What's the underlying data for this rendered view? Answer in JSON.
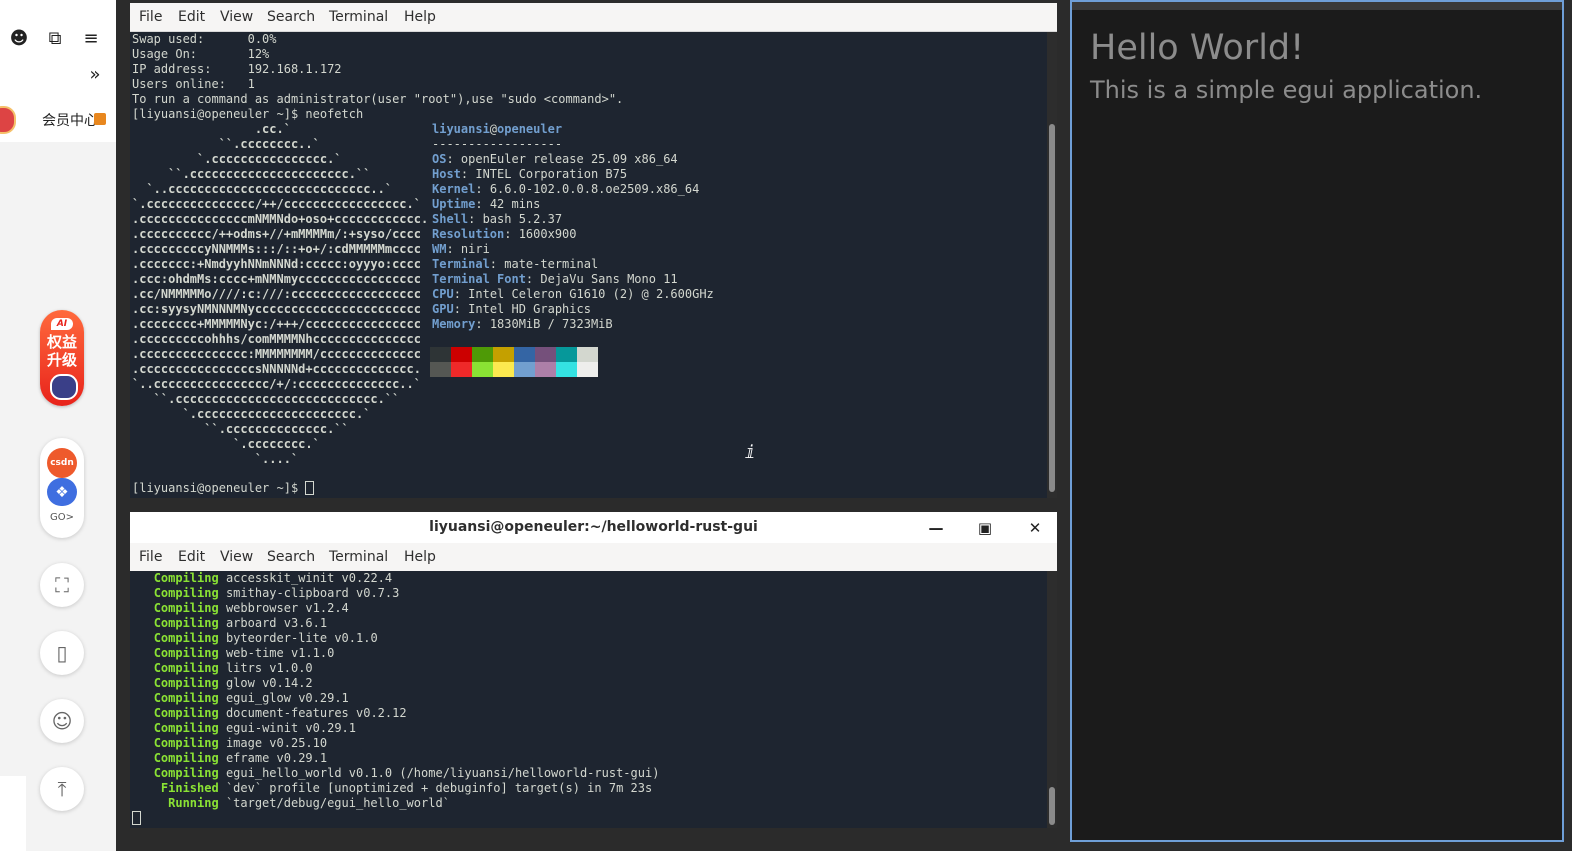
{
  "browser": {
    "toolbar": {
      "account_icon": "account-circle-icon",
      "extensions_icon": "puzzle-icon",
      "menu_icon": "hamburger-menu-icon",
      "more_icon": "double-chevron-right-icon"
    },
    "member_center": "会员中心",
    "promo": {
      "badge": "AI",
      "line1": "权益",
      "line2": "升级"
    },
    "csdn": {
      "logo": "csdn",
      "go": "GO>"
    },
    "side_buttons": [
      "fullscreen-icon",
      "mobile-icon",
      "chat-icon",
      "back-to-top-icon"
    ]
  },
  "term_top": {
    "menu": [
      "File",
      "Edit",
      "View",
      "Search",
      "Terminal",
      "Help"
    ],
    "sysinfo": [
      {
        "label": "Swap used:",
        "value": "0.0%"
      },
      {
        "label": "Usage On:",
        "value": "12%"
      },
      {
        "label": "IP address:",
        "value": "192.168.1.172"
      },
      {
        "label": "Users online:",
        "value": "1"
      }
    ],
    "sudo_hint": "To run a command as administrator(user \"root\"),use \"sudo <command>\".",
    "prompt": "[liyuansi@openeuler ~]$ ",
    "command": "neofetch",
    "logo_lines": [
      "                 .cc.`",
      "            ``.cccccccc..`",
      "         `.cccccccccccccccc.`",
      "     ``.cccccccccccccccccccccc.``",
      "  `..cccccccccccccccccccccccccccc..`",
      "`.ccccccccccccccc/++/ccccccccccccccccc.`",
      ".cccccccccccccccmNMMNdo+oso+cccccccccccc.",
      ".cccccccccc/++odms+//+mMMMMm/:+syso/cccc",
      ".cccccccccyNNMMMs:::/::+o+/:cdMMMMMmcccc",
      ".ccccccc:+NmdyyhNNmNNNd:ccccc:oyyyo:cccc",
      ".ccc:ohdmMs:cccc+mNMNmyccccccccccccccccc",
      ".cc/NMMMMMo////:c:///:cccccccccccccccccc",
      ".cc:syysyNMNNNMNyccccccccccccccccccccccc",
      ".cccccccc+MMMMMNyc:/+++/cccccccccccccccc",
      ".cccccccccohhhs/comMMMMNhccccccccccccccc",
      ".ccccccccccccccc:MMMMMMMM/cccccccccccccc",
      ".ccccccccccccccccsNNNNNd+cccccccccccccc.",
      "`..cccccccccccccccc/+/:cccccccccccccc..`",
      "   ``.cccccccccccccccccccccccccccc.``",
      "       `.cccccccccccccccccccccc.`",
      "          ``.cccccccccccccc.``",
      "              `.cccccccc.`",
      "                 `....`"
    ],
    "user": "liyuansi",
    "at": "@",
    "host": "openeuler",
    "separator": "------------------",
    "info": [
      {
        "key": "OS",
        "value": "openEuler release 25.09 x86_64"
      },
      {
        "key": "Host",
        "value": "INTEL Corporation B75"
      },
      {
        "key": "Kernel",
        "value": "6.6.0-102.0.0.8.oe2509.x86_64"
      },
      {
        "key": "Uptime",
        "value": "42 mins"
      },
      {
        "key": "Shell",
        "value": "bash 5.2.37"
      },
      {
        "key": "Resolution",
        "value": "1600x900"
      },
      {
        "key": "WM",
        "value": "niri"
      },
      {
        "key": "Terminal",
        "value": "mate-terminal"
      },
      {
        "key": "Terminal Font",
        "value": "DejaVu Sans Mono 11"
      },
      {
        "key": "CPU",
        "value": "Intel Celeron G1610 (2) @ 2.600GHz"
      },
      {
        "key": "GPU",
        "value": "Intel HD Graphics"
      },
      {
        "key": "Memory",
        "value": "1830MiB / 7323MiB"
      }
    ],
    "palette_dark": [
      "#2e3436",
      "#cc0000",
      "#4e9a06",
      "#c4a000",
      "#3465a4",
      "#75507b",
      "#06989a",
      "#d3d7cf"
    ],
    "palette_light": [
      "#555753",
      "#ef2929",
      "#8ae234",
      "#fce94f",
      "#729fcf",
      "#ad7fa8",
      "#34e2e2",
      "#eeeeec"
    ],
    "final_prompt": "[liyuansi@openeuler ~]$ "
  },
  "term_bottom": {
    "title": "liyuansi@openeuler:~/helloworld-rust-gui",
    "minimize_icon": "minimize-icon",
    "maximize_icon": "maximize-icon",
    "close_icon": "close-icon",
    "menu": [
      "File",
      "Edit",
      "View",
      "Search",
      "Terminal",
      "Help"
    ],
    "lines": [
      {
        "status": "Compiling",
        "text": "accesskit_winit v0.22.4"
      },
      {
        "status": "Compiling",
        "text": "smithay-clipboard v0.7.3"
      },
      {
        "status": "Compiling",
        "text": "webbrowser v1.2.4"
      },
      {
        "status": "Compiling",
        "text": "arboard v3.6.1"
      },
      {
        "status": "Compiling",
        "text": "byteorder-lite v0.1.0"
      },
      {
        "status": "Compiling",
        "text": "web-time v1.1.0"
      },
      {
        "status": "Compiling",
        "text": "litrs v1.0.0"
      },
      {
        "status": "Compiling",
        "text": "glow v0.14.2"
      },
      {
        "status": "Compiling",
        "text": "egui_glow v0.29.1"
      },
      {
        "status": "Compiling",
        "text": "document-features v0.2.12"
      },
      {
        "status": "Compiling",
        "text": "egui-winit v0.29.1"
      },
      {
        "status": "Compiling",
        "text": "image v0.25.10"
      },
      {
        "status": "Compiling",
        "text": "eframe v0.29.1"
      },
      {
        "status": "Compiling",
        "text": "egui_hello_world v0.1.0 (/home/liyuansi/helloworld-rust-gui)"
      },
      {
        "status": "Finished",
        "text": "`dev` profile [unoptimized + debuginfo] target(s) in 7m 23s"
      },
      {
        "status": "Running",
        "text": "`target/debug/egui_hello_world`"
      }
    ]
  },
  "egui": {
    "heading": "Hello World!",
    "body": "This is a simple egui application."
  },
  "colors": {
    "terminal_bg": "#1e2530",
    "accent_blue": "#729fcf",
    "cargo_green": "#8ae234",
    "egui_border": "#6f9fd8"
  }
}
